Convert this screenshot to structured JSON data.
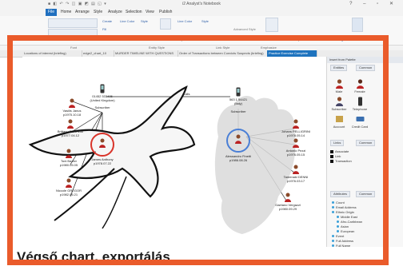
{
  "window": {
    "title": "i2 Analyst's Notebook",
    "quick_access": "■ ◧ ↶ ↷ ◫ ▣ ◩ ▤ ◱ ▾",
    "controls": "? – ▫ ✕"
  },
  "menu": {
    "file": "File",
    "items": [
      "Home",
      "Arrange",
      "Style",
      "Analyze",
      "Selection",
      "View",
      "Publish"
    ]
  },
  "ribbon": {
    "create_label": "Create",
    "line_color_label": "Line Color",
    "style_label": "Style",
    "fill_label": "Fill",
    "line_color_b_label": "Line Color",
    "style_b_label": "Style",
    "label_font": "Label Font",
    "line_font": "Line Font",
    "text_label": "Text",
    "layout_label": "Layout",
    "advanced_style": "Advanced Style",
    "representation": "Representation",
    "formatting": "Formatting ▾"
  },
  "groups": [
    "Font",
    "Entity Style",
    "Link Style",
    "Emphasize"
  ],
  "chart_tabs": [
    "Locations of interest (briefing)",
    "edge2_chart_10",
    "MURDER TIMELINE WITH QUESTIONS",
    "Order of Transactions between Convicts Suspects (briefing)",
    "Practice Exercise Complete"
  ],
  "chart": {
    "link_label": "Calls",
    "nodes": {
      "top_left": {
        "name": "Vasilis Janus",
        "number": "p1975.10.18"
      },
      "mid_left": {
        "name": "Brittany SORHAM",
        "number": "p1977.04.12"
      },
      "low_left": {
        "name": "Toni Baxter",
        "number": "p1980.05.05"
      },
      "bottom_left": {
        "name": "Niccole GREGOR",
        "number": "p1982.06.21"
      },
      "phone_left": {
        "name": "01452 533405",
        "number": "(United Kingdom)"
      },
      "subscriber_left": "Subscriber",
      "center_left": {
        "name": "James Anthony",
        "number": "p1978.07.22"
      },
      "phone_right": {
        "name": "563 1 54421",
        "number": "(Italy)"
      },
      "subscriber_right": "Subscriber",
      "right_top": {
        "name": "Johans PELLIGRINI",
        "number": "p1978.05.14"
      },
      "right_mid": {
        "name": "Antonio Pezzi",
        "number": "p1976.05.15"
      },
      "right_low": {
        "name": "Tamenaki DENNI",
        "number": "p1976.03.17"
      },
      "right_bottom": {
        "name": "Gaetano Vergazzi",
        "number": "p1980.09.29"
      },
      "center_right": {
        "name": "Alessandro Finetti",
        "number": "p1986.08.26"
      }
    }
  },
  "panel": {
    "title": "Insert from Palette",
    "entity_tab": "Entities",
    "common_tab": "Common",
    "entities": [
      "Male",
      "Female",
      "Subscriber",
      "Telephone",
      "Account",
      "Credit Card"
    ],
    "links_tab": "Links",
    "links_common": "Common",
    "links": [
      "Associate",
      "Link",
      "Transaction"
    ],
    "attributes_tab": "Attributes",
    "attributes_common": "Common",
    "attributes": [
      "Count",
      "Email Address",
      "Ethnic Origin",
      "Middle East",
      "Afro-Caribbean",
      "Asian",
      "European",
      "Event",
      "Full Address",
      "Full Name"
    ]
  },
  "caption": "Végső chart, exportálás",
  "colors": {
    "frame": "#ea5b2b",
    "active_tab": "#1e73be",
    "highlight_ring": "#d9342a"
  }
}
